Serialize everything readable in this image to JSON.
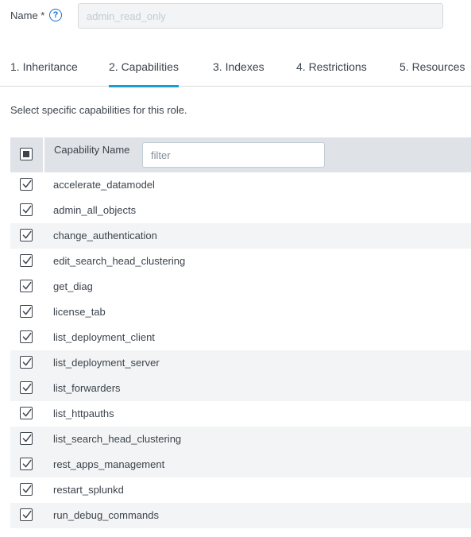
{
  "name_field": {
    "label": "Name *",
    "help_icon": "?",
    "value": "admin_read_only"
  },
  "tabs": [
    {
      "label": "1. Inheritance",
      "active": false
    },
    {
      "label": "2. Capabilities",
      "active": true
    },
    {
      "label": "3. Indexes",
      "active": false
    },
    {
      "label": "4. Restrictions",
      "active": false
    },
    {
      "label": "5. Resources",
      "active": false
    }
  ],
  "intro_text": "Select specific capabilities for this role.",
  "table": {
    "column_header": "Capability Name",
    "filter_placeholder": "filter",
    "select_all_state": "partial",
    "rows": [
      {
        "name": "accelerate_datamodel",
        "checked": true,
        "shaded": false
      },
      {
        "name": "admin_all_objects",
        "checked": true,
        "shaded": false
      },
      {
        "name": "change_authentication",
        "checked": true,
        "shaded": true
      },
      {
        "name": "edit_search_head_clustering",
        "checked": true,
        "shaded": false
      },
      {
        "name": "get_diag",
        "checked": true,
        "shaded": false
      },
      {
        "name": "license_tab",
        "checked": true,
        "shaded": false
      },
      {
        "name": "list_deployment_client",
        "checked": true,
        "shaded": false
      },
      {
        "name": "list_deployment_server",
        "checked": true,
        "shaded": true
      },
      {
        "name": "list_forwarders",
        "checked": true,
        "shaded": true
      },
      {
        "name": "list_httpauths",
        "checked": true,
        "shaded": false
      },
      {
        "name": "list_search_head_clustering",
        "checked": true,
        "shaded": true
      },
      {
        "name": "rest_apps_management",
        "checked": true,
        "shaded": true
      },
      {
        "name": "restart_splunkd",
        "checked": true,
        "shaded": false
      },
      {
        "name": "run_debug_commands",
        "checked": true,
        "shaded": true
      }
    ]
  },
  "colors": {
    "accent": "#1a9cd6",
    "link": "#1a6dc7",
    "header_bg": "#dfe2e6",
    "row_shade": "#f2f4f5",
    "text": "#3c444d"
  }
}
